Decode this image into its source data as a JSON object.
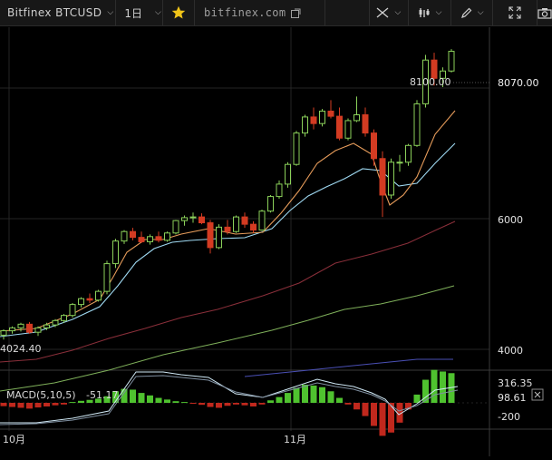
{
  "toolbar": {
    "symbol_label": "Bitfinex BTCUSD",
    "interval_label": "1日",
    "star_icon": "star-icon",
    "site_label": "bitfinex.com",
    "tools": [
      "crosshair-icon",
      "candle-style-icon",
      "pencil-icon",
      "fullscreen-icon",
      "camera-icon"
    ]
  },
  "price_axis": {
    "current_price": "8070.00",
    "ticks": [
      "6000",
      "4000"
    ],
    "high_label": "8100.00",
    "low_label": "4024.40"
  },
  "macd": {
    "label": "MACD(5,10,5)",
    "value": "-51.17",
    "axis_ticks": [
      "316.35",
      "98.61",
      "-200"
    ]
  },
  "time_axis": {
    "labels": [
      "10月",
      "11月"
    ]
  },
  "colors": {
    "up": "#8bd15a",
    "down": "#d33b22",
    "ma5": "#e59b5a",
    "ma10": "#9fd9f2",
    "ma30": "#8a2f3a",
    "ma60": "#7fb05a",
    "ma120": "#4a4fb5",
    "macd_pos": "#4fc22f",
    "macd_neg": "#c0281d"
  },
  "chart_data": {
    "type": "candlestick",
    "dates_note": "",
    "candles": [
      [
        4180,
        4260,
        4120,
        4240
      ],
      [
        4240,
        4300,
        4200,
        4280
      ],
      [
        4280,
        4350,
        4230,
        4330
      ],
      [
        4330,
        4360,
        4200,
        4220
      ],
      [
        4220,
        4300,
        4170,
        4280
      ],
      [
        4280,
        4350,
        4250,
        4320
      ],
      [
        4320,
        4400,
        4290,
        4380
      ],
      [
        4380,
        4470,
        4350,
        4450
      ],
      [
        4450,
        4620,
        4420,
        4600
      ],
      [
        4600,
        4700,
        4560,
        4680
      ],
      [
        4680,
        4750,
        4620,
        4660
      ],
      [
        4660,
        4800,
        4640,
        4780
      ],
      [
        4780,
        5200,
        4740,
        5160
      ],
      [
        5160,
        5500,
        5100,
        5470
      ],
      [
        5470,
        5620,
        5430,
        5600
      ],
      [
        5600,
        5650,
        5480,
        5520
      ],
      [
        5520,
        5600,
        5440,
        5460
      ],
      [
        5460,
        5560,
        5420,
        5530
      ],
      [
        5530,
        5600,
        5450,
        5480
      ],
      [
        5480,
        5600,
        5460,
        5580
      ],
      [
        5580,
        5760,
        5560,
        5750
      ],
      [
        5750,
        5820,
        5680,
        5790
      ],
      [
        5790,
        5860,
        5720,
        5800
      ],
      [
        5800,
        5850,
        5700,
        5720
      ],
      [
        5720,
        5760,
        5300,
        5380
      ],
      [
        5380,
        5700,
        5360,
        5660
      ],
      [
        5660,
        5760,
        5560,
        5600
      ],
      [
        5600,
        5820,
        5580,
        5800
      ],
      [
        5800,
        5860,
        5650,
        5700
      ],
      [
        5700,
        5740,
        5580,
        5620
      ],
      [
        5620,
        5900,
        5610,
        5880
      ],
      [
        5880,
        6100,
        5860,
        6080
      ],
      [
        6080,
        6300,
        6050,
        6250
      ],
      [
        6250,
        6550,
        6200,
        6520
      ],
      [
        6520,
        6980,
        6500,
        6950
      ],
      [
        6950,
        7200,
        6900,
        7170
      ],
      [
        7170,
        7300,
        7000,
        7080
      ],
      [
        7080,
        7280,
        7040,
        7250
      ],
      [
        7250,
        7400,
        7150,
        7180
      ],
      [
        7180,
        7300,
        6850,
        6880
      ],
      [
        6880,
        7150,
        6850,
        7120
      ],
      [
        7120,
        7450,
        7100,
        7200
      ],
      [
        7200,
        7300,
        6900,
        6950
      ],
      [
        6950,
        7000,
        6500,
        6600
      ],
      [
        6600,
        6700,
        5800,
        6100
      ],
      [
        6100,
        6600,
        6050,
        6550
      ],
      [
        6550,
        6650,
        6420,
        6550
      ],
      [
        6550,
        6800,
        6500,
        6780
      ],
      [
        6780,
        7400,
        6760,
        7350
      ],
      [
        7350,
        8020,
        7300,
        7950
      ],
      [
        7950,
        8050,
        7600,
        7700
      ],
      [
        7700,
        7850,
        7580,
        7800
      ],
      [
        7800,
        8100,
        7780,
        8070
      ]
    ],
    "macd_hist": [
      -20,
      -25,
      -30,
      -35,
      -28,
      -22,
      -15,
      -10,
      5,
      12,
      18,
      25,
      40,
      70,
      85,
      80,
      60,
      45,
      30,
      20,
      10,
      5,
      -5,
      -12,
      -25,
      -30,
      -18,
      -10,
      -15,
      -22,
      -10,
      15,
      35,
      60,
      90,
      110,
      105,
      95,
      70,
      30,
      -10,
      -40,
      -80,
      -140,
      -200,
      -180,
      -120,
      -40,
      50,
      140,
      200,
      190,
      180
    ],
    "ylim": [
      3700,
      8400
    ]
  }
}
